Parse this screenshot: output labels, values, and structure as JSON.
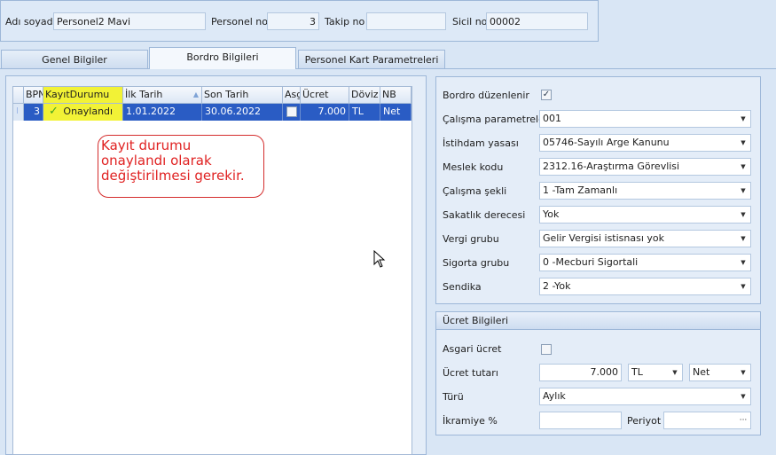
{
  "header": {
    "name_label": "Adı soyadı",
    "name_value": "Personel2 Mavi",
    "personel_no_label": "Personel no",
    "personel_no_value": "3",
    "takip_no_label": "Takip no",
    "takip_no_value": "",
    "sicil_no_label": "Sicil no",
    "sicil_no_value": "00002"
  },
  "tabs": [
    {
      "label": "Genel Bilgiler",
      "active": false
    },
    {
      "label": "Bordro Bilgileri",
      "active": true
    },
    {
      "label": "Personel Kart Parametreleri",
      "active": false
    }
  ],
  "grid": {
    "columns": [
      "BPN",
      "KayıtDurumu",
      "İlk Tarih",
      "Son Tarih",
      "Asg",
      "Ücret",
      "Döviz",
      "NB"
    ],
    "sorted_column": "İlk Tarih",
    "rows": [
      {
        "bpn": "3",
        "kayit_durumu": "Onaylandı",
        "ilk_tarih": "1.01.2022",
        "son_tarih": "30.06.2022",
        "asg": false,
        "ucret": "7.000",
        "doviz": "TL",
        "nb": "Net"
      }
    ],
    "row_indicator": "I"
  },
  "callout": {
    "line1": "Kayıt durumu",
    "line2": "onaylandı olarak",
    "line3": "değiştirilmesi gerekir."
  },
  "params": {
    "bordro_duzenlenir_label": "Bordro düzenlenir",
    "bordro_duzenlenir_checked": true,
    "calisma_parametreleri_label": "Çalışma parametreleri",
    "calisma_parametreleri_value": "001",
    "istihdam_yasasi_label": "İstihdam yasası",
    "istihdam_yasasi_value": "05746-Sayılı Arge Kanunu",
    "meslek_kodu_label": "Meslek kodu",
    "meslek_kodu_value": "2312.16-Araştırma Görevlisi",
    "calisma_sekli_label": "Çalışma şekli",
    "calisma_sekli_value": "1 -Tam Zamanlı",
    "sakatlik_derecesi_label": "Sakatlık derecesi",
    "sakatlik_derecesi_value": "Yok",
    "vergi_grubu_label": "Vergi grubu",
    "vergi_grubu_value": "Gelir Vergisi istisnası yok",
    "sigorta_grubu_label": "Sigorta grubu",
    "sigorta_grubu_value": "0 -Mecburi Sigortali",
    "sendika_label": "Sendika",
    "sendika_value": "2 -Yok"
  },
  "wage": {
    "title": "Ücret Bilgileri",
    "asgari_ucret_label": "Asgari ücret",
    "asgari_ucret_checked": false,
    "ucret_tutari_label": "Ücret tutarı",
    "ucret_tutari_value": "7.000",
    "currency_value": "TL",
    "net_brut_value": "Net",
    "turu_label": "Türü",
    "turu_value": "Aylık",
    "ikramiye_label": "İkramiye %",
    "ikramiye_value": "",
    "periyot_label": "Periyot",
    "periyot_value": "",
    "ellipsis": "···"
  },
  "colors": {
    "highlight": "#f2f236",
    "selected_row": "#2a5cc4",
    "callout_text": "#e02222",
    "callout_border": "#d42c2c"
  },
  "icons": {
    "check": "check-icon",
    "dropdown": "chevron-down-icon",
    "sort": "sort-asc-icon",
    "cursor": "mouse-pointer-icon"
  }
}
